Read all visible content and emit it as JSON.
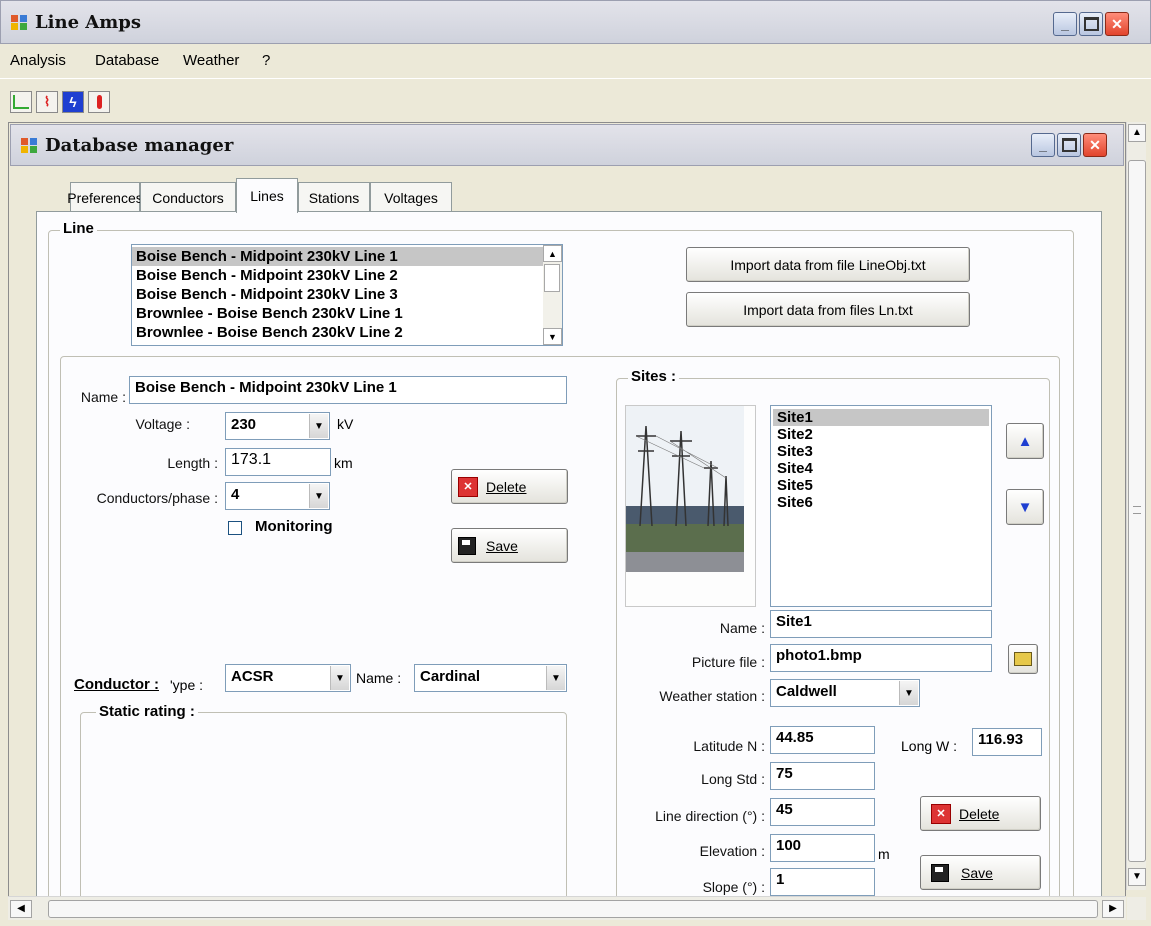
{
  "app": {
    "title": "Line Amps"
  },
  "menu": {
    "analysis": "Analysis",
    "database": "Database",
    "weather": "Weather",
    "help": "?"
  },
  "toolbar": {
    "icons": [
      "line-chart-icon",
      "pulse-icon",
      "lightning-icon",
      "thermometer-icon"
    ]
  },
  "child": {
    "title": "Database manager"
  },
  "tabs": {
    "preferences": "Preferences",
    "conductors": "Conductors",
    "lines": "Lines",
    "stations": "Stations",
    "voltages": "Voltages"
  },
  "line_group": {
    "legend": "Line"
  },
  "lines_list": [
    "Boise Bench - Midpoint 230kV Line 1",
    "Boise Bench - Midpoint 230kV Line 2",
    "Boise Bench - Midpoint 230kV Line 3",
    "Brownlee - Boise Bench 230kV Line 1",
    "Brownlee - Boise Bench 230kV Line 2"
  ],
  "import": {
    "lineobj": "Import data from file LineObj.txt",
    "ln": "Import data from files Ln.txt"
  },
  "line_form": {
    "name_label": "Name :",
    "name_value": "Boise Bench - Midpoint 230kV Line 1",
    "voltage_label": "Voltage :",
    "voltage_value": "230",
    "voltage_unit": "kV",
    "length_label": "Length :",
    "length_value": "173.1",
    "length_unit": "km",
    "cond_phase_label": "Conductors/phase :",
    "cond_phase_value": "4",
    "monitoring_label": "Monitoring",
    "monitoring_checked": false,
    "delete_label": "Delete",
    "save_label": "Save",
    "conductor_label": "Conductor :",
    "type_label": "'ype :",
    "type_value": "ACSR",
    "cname_label": "Name :",
    "cname_value": "Cardinal",
    "static_rating_legend": "Static rating :"
  },
  "sites": {
    "legend": "Sites :",
    "items": [
      "Site1",
      "Site2",
      "Site3",
      "Site4",
      "Site5",
      "Site6"
    ],
    "name_label": "Name :",
    "name_value": "Site1",
    "picture_label": "Picture file :",
    "picture_value": "photo1.bmp",
    "weather_label": "Weather station :",
    "weather_value": "Caldwell",
    "lat_label": "Latitude N :",
    "lat_value": "44.85",
    "longw_label": "Long W :",
    "longw_value": "116.93",
    "longstd_label": "Long Std :",
    "longstd_value": "75",
    "dir_label": "Line direction (°) :",
    "dir_value": "45",
    "elev_label": "Elevation :",
    "elev_value": "100",
    "elev_unit": "m",
    "slope_label": "Slope (°) :",
    "slope_value": "1",
    "delete_label": "Delete",
    "save_label": "Save"
  },
  "colors": {
    "titlebar": "#cfd2dc",
    "selection": "#c6c6c6",
    "accent_blue": "#1f3fd1",
    "close_red": "#e2442c"
  }
}
